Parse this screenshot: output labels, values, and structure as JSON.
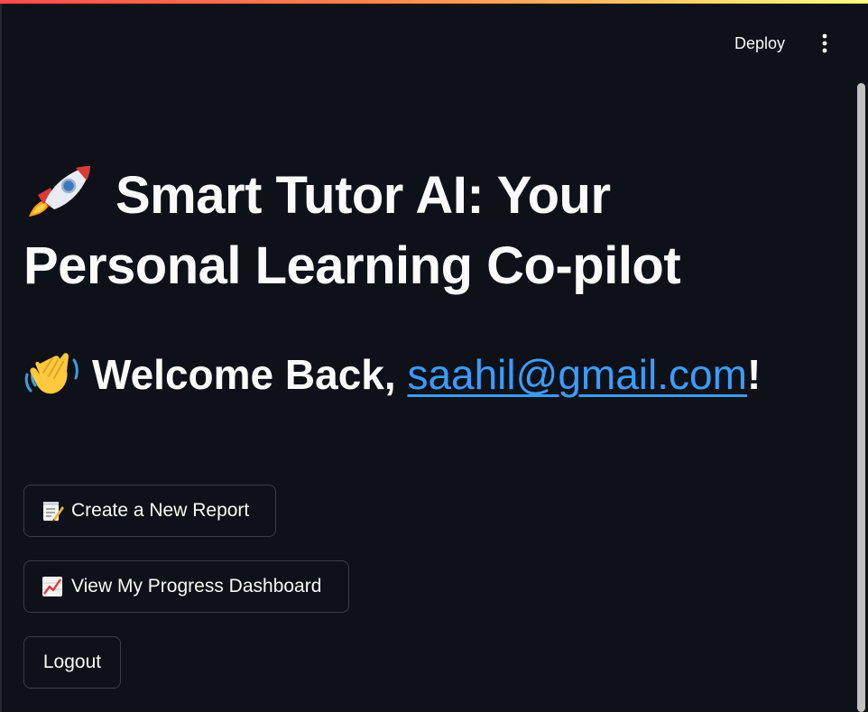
{
  "header": {
    "deploy_label": "Deploy",
    "menu_icon": "more-vertical-icon"
  },
  "main": {
    "title_icon": "rocket-icon",
    "title": "Smart Tutor AI: Your Personal Learning Co-pilot",
    "welcome_icon": "waving-hand-icon",
    "welcome_prefix": "Welcome Back, ",
    "welcome_email": "saahil@gmail.com",
    "welcome_suffix": "!",
    "buttons": {
      "create_report": {
        "icon": "memo-icon",
        "label": "Create a New Report"
      },
      "progress_dashboard": {
        "icon": "chart-increasing-icon",
        "label": "View My Progress Dashboard"
      },
      "logout": {
        "label": "Logout"
      }
    }
  },
  "colors": {
    "background": "#0e1117",
    "text": "#fafafa",
    "link": "#3b9cff",
    "button_border": "#3a3d46",
    "accent_start": "#ff4b4b",
    "accent_end": "#fffd80"
  }
}
